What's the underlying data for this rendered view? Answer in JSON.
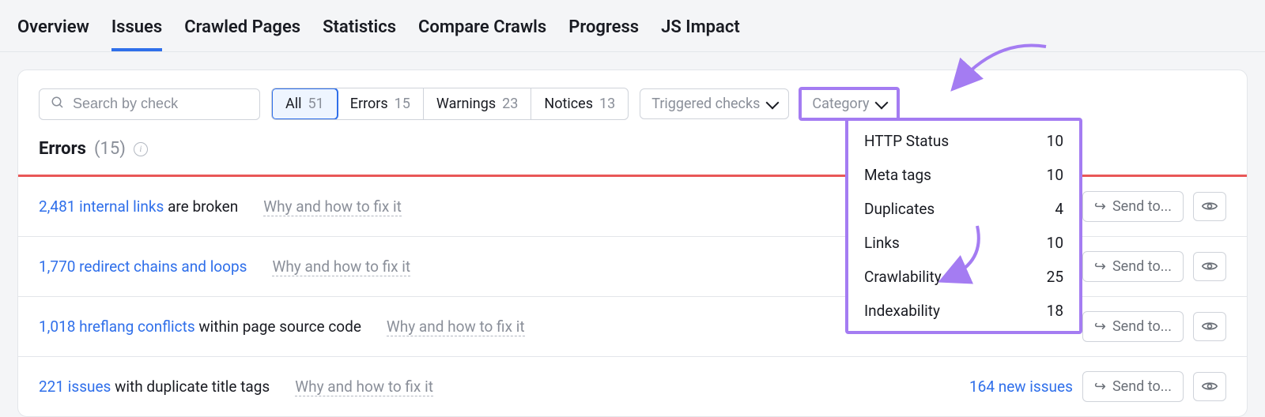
{
  "tabs": [
    "Overview",
    "Issues",
    "Crawled Pages",
    "Statistics",
    "Compare Crawls",
    "Progress",
    "JS Impact"
  ],
  "active_tab": 1,
  "search": {
    "placeholder": "Search by check"
  },
  "filters": {
    "items": [
      {
        "label": "All",
        "count": 51,
        "active": true
      },
      {
        "label": "Errors",
        "count": 15
      },
      {
        "label": "Warnings",
        "count": 23
      },
      {
        "label": "Notices",
        "count": 13
      }
    ]
  },
  "triggered": "Triggered checks",
  "category_label": "Category",
  "errors_heading": {
    "title": "Errors",
    "count": "(15)"
  },
  "rows": [
    {
      "count": "2,481",
      "link": "internal links",
      "rest": "are broken",
      "fix": "Why and how to fix it",
      "send": "Send to...",
      "new": null
    },
    {
      "count": "1,770",
      "link": "redirect chains and loops",
      "rest": "",
      "fix": "Why and how to fix it",
      "send": "Send to...",
      "new": null
    },
    {
      "count": "1,018",
      "link": "hreflang conflicts",
      "rest": "within page source code",
      "fix": "Why and how to fix it",
      "send": "Send to...",
      "new": null
    },
    {
      "count": "221",
      "link": "issues",
      "rest": "with duplicate title tags",
      "fix": "Why and how to fix it",
      "send": "Send to...",
      "new": "164 new issues"
    }
  ],
  "menu": [
    {
      "label": "HTTP Status",
      "count": 10
    },
    {
      "label": "Meta tags",
      "count": 10
    },
    {
      "label": "Duplicates",
      "count": 4
    },
    {
      "label": "Links",
      "count": 10
    },
    {
      "label": "Crawlability",
      "count": 25
    },
    {
      "label": "Indexability",
      "count": 18
    }
  ]
}
